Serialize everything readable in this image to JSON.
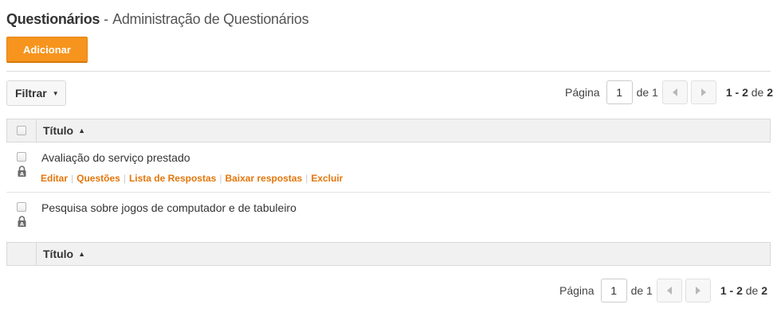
{
  "header": {
    "title": "Questionários",
    "separator": " - ",
    "subtitle": "Administração de Questionários"
  },
  "toolbar": {
    "add_label": "Adicionar",
    "filter_label": "Filtrar"
  },
  "pager": {
    "page_label": "Página",
    "current_page": "1",
    "of_label": "de 1",
    "range": "1 - 2",
    "range_of": "de",
    "total": "2"
  },
  "table": {
    "column_title": "Título",
    "rows": [
      {
        "title": "Avaliação do serviço prestado",
        "actions": [
          "Editar",
          "Questões",
          "Lista de Respostas",
          "Baixar respostas",
          "Excluir"
        ]
      },
      {
        "title": "Pesquisa sobre jogos de computador e de tabuleiro"
      }
    ]
  },
  "colors": {
    "accent": "#f7941d",
    "link": "#e4760a",
    "header_bg": "#f1f1f1"
  },
  "icons": {
    "sort": "triangle-up-icon",
    "lock": "lock-icon",
    "prev": "chevron-left-icon",
    "next": "chevron-right-icon",
    "caret": "caret-down-icon"
  }
}
